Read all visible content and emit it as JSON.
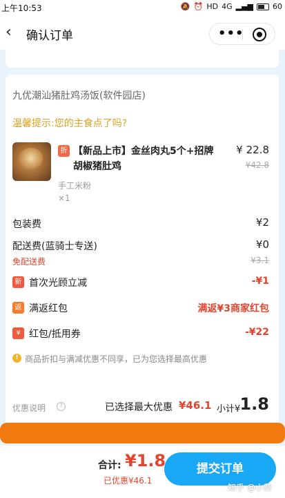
{
  "status_bar": {
    "time": "上午10:53",
    "signal": "4G",
    "hd": "HD",
    "battery": "60"
  },
  "nav": {
    "title": "确认订单",
    "more": "•••"
  },
  "shop": {
    "name": "九优潮汕猪肚鸡汤饭(软件园店)"
  },
  "tip": "温馨提示:您的主食点了吗?",
  "item": {
    "tag": "折",
    "name": "【新品上市】金丝肉丸5个+招牌胡椒猪肚鸡",
    "spec": "手工米粉",
    "qty": "×1",
    "price": "¥ 22.8",
    "original_price": "¥42.8"
  },
  "fees": {
    "packing_label": "包装费",
    "packing_value": "¥2",
    "delivery_label": "配送费(蓝骑士专送)",
    "delivery_value": "¥0",
    "free_delivery": "免配送费",
    "delivery_original": "¥3.1"
  },
  "promos": [
    {
      "icon": "新",
      "label": "首次光顾立减",
      "value": "-¥1"
    },
    {
      "icon": "返",
      "label": "满返红包",
      "value": "满返¥3商家红包"
    },
    {
      "icon": "¥",
      "label": "红包/抵用券",
      "value": "-¥22"
    }
  ],
  "notice": "商品折扣与满减优惠不同享，已为您选择最高优惠",
  "summary": {
    "help_label": "优惠说明",
    "max_label": "已选择最大优惠",
    "max_amount": "¥46.1",
    "subtotal_label": "小计¥",
    "subtotal_amount": "1.8"
  },
  "footer": {
    "total_label": "合计:",
    "total_amount": "¥1.8",
    "saved": "已优惠¥46.1",
    "submit": "提交订单",
    "watermark": "知乎 @小葵"
  },
  "colors": {
    "accent_red": "#e2452f",
    "submit_blue": "#18a8f5",
    "tip_yellow": "#e0a020",
    "highlight_orange": "#f07a10"
  }
}
